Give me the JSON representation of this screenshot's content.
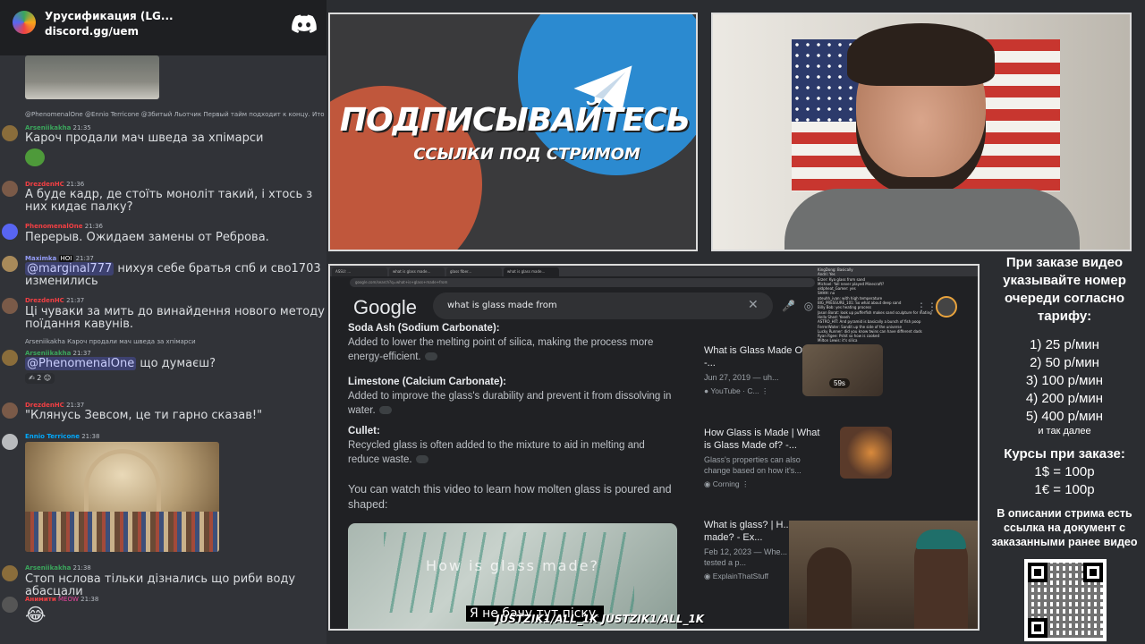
{
  "server": {
    "name": "Урусификация (LG...",
    "link": "discord.gg/uem"
  },
  "messages": [
    {
      "reply": "@PhenomenalOne  @Ennio Terricone  @Збитый Льотчик  Первый тайм подходит к концу. Ито",
      "nick": "Arseniikakha",
      "time": "21:35",
      "text": "Кароч продали мач шведа за хпімарси"
    },
    {
      "nick": "DrezdenHC",
      "time": "21:36",
      "text": "А буде кадр, де стоїть моноліт такий, і хтось з них кидає палку?"
    },
    {
      "nick": "PhenomenalOne",
      "time": "21:36",
      "text": "Перерыв. Ожидаем замены от Реброва."
    },
    {
      "nick": "Maximka",
      "badge": "HOI",
      "time": "21:37",
      "mention": "@marginal777",
      "text": " нихуя себе братья спб и сво1703 изменились"
    },
    {
      "nick": "DrezdenHC",
      "time": "21:37",
      "text": "Ці чуваки за мить до винайдення нового методу поїдання кавунів."
    },
    {
      "reply": "Arseniikakha  Кароч продали мач шведа за хпімарси",
      "nick": "Arseniikakha",
      "time": "21:37",
      "mention": "@PhenomenalOne",
      "text": " що думаєш?",
      "reactions": "2"
    },
    {
      "nick": "DrezdenHC",
      "time": "21:37",
      "text": "\"Клянусь Зевсом, це ти гарно сказав!\""
    },
    {
      "nick": "Ennio Terricone",
      "time": "21:38"
    },
    {
      "nick": "Arseniikakha",
      "time": "21:38",
      "text": "Стоп нслова тільки дізнались що риби воду абасцали"
    },
    {
      "nick": "Анимити",
      "badge": "MEOW",
      "time": "21:38",
      "text": "😂"
    }
  ],
  "promo": {
    "title": "ПОДПИСЫВАЙТЕСЬ",
    "subtitle": "ССЫЛКИ ПОД СТРИМОМ"
  },
  "browser": {
    "tabs": [
      "ASSU: ...",
      "what is glass made...",
      "glass fiber...",
      "what is glass made..."
    ],
    "url": "google.com/search?q=what+is+glass+made+from",
    "logo": "Google",
    "query": "what is glass made from",
    "results": [
      {
        "heading": "Soda Ash (Sodium Carbonate):",
        "body": "Added to lower the melting point of silica, making the process more energy-efficient."
      },
      {
        "heading": "Limestone (Calcium Carbonate):",
        "body": "Added to improve the glass's durability and prevent it from dissolving in water."
      },
      {
        "heading": "Cullet:",
        "body": "Recycled glass is often added to the mixture to aid in melting and reduce waste."
      }
    ],
    "video_prompt": "You can watch this video to learn how molten glass is poured and shaped:",
    "video_title": "How is glass made?",
    "side_cards": [
      {
        "title": "What is Glass Made Of? -...",
        "date": "Jun 27, 2019 — uh...",
        "source": "YouTube · C...",
        "duration": "59s"
      },
      {
        "title": "How Glass is Made | What is Glass Made of? -...",
        "date": "Glass's properties can also change based on how it's...",
        "source": "Corning"
      },
      {
        "title": "What is glass? | H... glass made? - Ex...",
        "date": "Feb 12, 2023 — Whe... scientists tested a p...",
        "source": "ExplainThatStuff"
      }
    ],
    "chat_lines": [
      "KingDong: Basically",
      "Andri: Yes",
      "Erzer: Kya glass from sand",
      "Michael: Yall never played Minecraft?",
      "oldpheat_Gamer: yes",
      "SHHH: no",
      "ateuhh_ivan: with high temperature",
      "BIG_PRESSURE_101: So what about deep sand",
      "Billy Bob: yes heating process",
      "Jason Borat: look up pufferfish makes sand sculpture for mating",
      "Hello Shed: Yeeeh",
      "ASTRO_HIT: And pyramid is basically a bunch of fish poop",
      "FerrerWater: Sandit up the side of the universe",
      "Lucky Runner: did you know twins can have different dads",
      "Ryan Rgee: Pshit so how is cooked",
      "Milton Lewis: it's silica"
    ],
    "subtitle": "Я не бачу тут піску.",
    "social": "JUSTZIK1/ALL_1K   JUSTZIK1/ALL_1K"
  },
  "info": {
    "order_text": "При заказе видео указывайте номер очереди согласно тарифу:",
    "prices": [
      "1) 25 р/мин",
      "2) 50 р/мин",
      "3) 100 р/мин",
      "4) 200 р/мин",
      "5) 400 р/мин"
    ],
    "etc": "и так далее",
    "courses": "Курсы при заказе:",
    "rates": [
      "1$ = 100р",
      "1€ = 100р"
    ],
    "description": "В описании стрима есть ссылка на документ с заказанными ранее видео"
  },
  "colors": {
    "discord_bg": "#313338",
    "accent_red": "#f23f43",
    "mention_bg": "#5865f2",
    "google_dark": "#202124"
  }
}
